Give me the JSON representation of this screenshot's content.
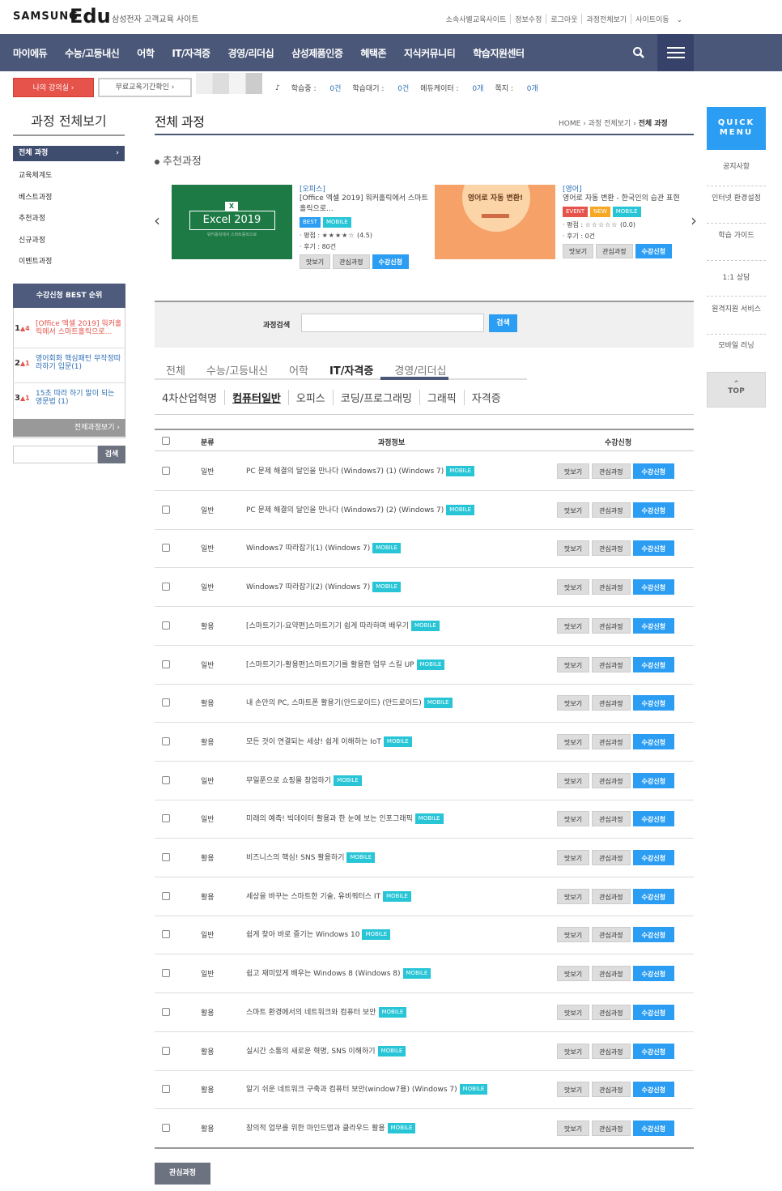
{
  "header": {
    "brand": "SAMSUNG",
    "logo": "Edu",
    "subtitle": "삼성전자 고객교육 사이트",
    "util": [
      "소속사별교육사이트",
      "정보수정",
      "로그아웃",
      "과정전체보기",
      "사이트이동"
    ],
    "util_arrow": "⌄"
  },
  "gnb": {
    "menus": [
      "마이에듀",
      "수능/고등내신",
      "어학",
      "IT/자격증",
      "경영/리더십",
      "삼성제품인증",
      "혜택존",
      "지식커뮤니티",
      "학습지원센터"
    ],
    "search_icon": "search-icon",
    "menu_icon": "hamburger-icon"
  },
  "subbar": {
    "my_class": "나의 강의실 ›",
    "free_period": "무료교육기간확인 ›",
    "music_note": "♪",
    "counts": [
      {
        "label": "학습중 : ",
        "value": "0건"
      },
      {
        "label": "학습대기 : ",
        "value": "0건"
      },
      {
        "label": "에듀케이터 : ",
        "value": "0개"
      },
      {
        "label": "쪽지 : ",
        "value": "0개"
      }
    ]
  },
  "left": {
    "title": "과정 전체보기",
    "active": "전체 과정",
    "active_arrow": "›",
    "items": [
      "교육체계도",
      "베스트과정",
      "추천과정",
      "신규과정",
      "이벤트과정"
    ],
    "best_title": "수강신청 BEST 순위",
    "best": [
      {
        "rank": "1",
        "arrow": "▲4",
        "text": "[Office 엑셀 2019] 워커홀릭에서 스마트홀릭으로..."
      },
      {
        "rank": "2",
        "arrow": "▲1",
        "text": "영어회화 핵심패턴 무작정따라하기 입문(1)"
      },
      {
        "rank": "3",
        "arrow": "▲1",
        "text": "15초 따라 하기 말이 되는 영문법 (1)"
      }
    ],
    "best_all": "전체과정보기 ›",
    "search_btn": "검색"
  },
  "quick": {
    "title": "QUICK MENU",
    "items": [
      "공지사항",
      "인터넷 환경설정",
      "학습 가이드",
      "1:1 상담",
      "원격지원 서비스",
      "모바일 러닝"
    ],
    "top_arrow": "⌃",
    "top": "TOP"
  },
  "main": {
    "title": "전체 과정",
    "breadcrumb": [
      "HOME",
      "과정 전체보기",
      "전체 과정"
    ],
    "crumb_sep": "›",
    "rec_title": "추천과정",
    "prev": "‹",
    "next": "›",
    "cards": [
      {
        "image_text": "Excel 2019",
        "image_icon": "X",
        "image_sub": "워커홀릭에서 스마트홀릭으로",
        "cat": "[오피스]",
        "name": "[Office 엑셀 2019] 워커홀릭에서 스마트홀릭으로...",
        "tags": [
          "BEST",
          "MOBILE"
        ],
        "rating_label": "· 평점 : ",
        "stars": "★★★★☆",
        "rating": "(4.5)",
        "reviews": "· 후기 : 80건"
      },
      {
        "image_text": "영어로 자동 변환!",
        "cat": "[영어]",
        "name": "영어로 자동 변환 - 한국인의 습관 표현",
        "tags": [
          "EVENT",
          "NEW",
          "MOBILE"
        ],
        "rating_label": "· 평점 : ",
        "stars": "☆☆☆☆☆",
        "rating": "(0.0)",
        "reviews": "· 후기 : 0건"
      }
    ],
    "card_buttons": [
      "맛보기",
      "관심과정",
      "수강신청"
    ],
    "search_label": "과정검색",
    "search_btn": "검색",
    "tabs": [
      "전체",
      "수능/고등내신",
      "어학",
      "IT/자격증",
      "경영/리더십"
    ],
    "subtabs": [
      "4차산업혁명",
      "컴퓨터일반",
      "오피스",
      "코딩/프로그래밍",
      "그래픽",
      "자격증"
    ],
    "table_head": [
      "분류",
      "과정정보",
      "수강신청"
    ],
    "mobile_tag": "MOBILE",
    "row_buttons": [
      "맛보기",
      "관심과정",
      "수강신청"
    ],
    "rows": [
      {
        "cat": "일반",
        "name": "PC 문제 해결의 달인을 만나다 (Windows7) (1) (Windows 7)"
      },
      {
        "cat": "일반",
        "name": "PC 문제 해결의 달인을 만나다 (Windows7) (2) (Windows 7)"
      },
      {
        "cat": "일반",
        "name": "Windows7 따라잡기(1) (Windows 7)"
      },
      {
        "cat": "일반",
        "name": "Windows7 따라잡기(2) (Windows 7)"
      },
      {
        "cat": "활용",
        "name": "[스마트기기-요약편]스마트기기 쉽게 따라하며 배우기"
      },
      {
        "cat": "일반",
        "name": "[스마트기기-활용편]스마트기기를 활용한 업무 스킬 UP"
      },
      {
        "cat": "활용",
        "name": "내 손안의 PC, 스마트폰 활용기(안드로이드) (안드로이드)"
      },
      {
        "cat": "활용",
        "name": "모든 것이 연결되는 세상! 쉽게 이해하는 IoT"
      },
      {
        "cat": "일반",
        "name": "무일푼으로 쇼핑몰 창업하기"
      },
      {
        "cat": "일반",
        "name": "미래의 예측! 빅데이터 활용과 한 눈에 보는 인포그래픽"
      },
      {
        "cat": "활용",
        "name": "비즈니스의 핵심! SNS 활용하기"
      },
      {
        "cat": "활용",
        "name": "세상을 바꾸는 스마트한 기술, 유비쿼터스 IT"
      },
      {
        "cat": "일반",
        "name": "쉽게 찾아 바로 즐기는 Windows 10"
      },
      {
        "cat": "일반",
        "name": "쉽고 재미있게 배우는 Windows 8 (Windows 8)"
      },
      {
        "cat": "활용",
        "name": "스마트 환경에서의 네트워크와 컴퓨터 보안"
      },
      {
        "cat": "활용",
        "name": "실시간 소통의 새로운 혁명, SNS 이해하기"
      },
      {
        "cat": "활용",
        "name": "알기 쉬운 네트워크 구축과 컴퓨터 보안(window7용) (Windows 7)"
      },
      {
        "cat": "활용",
        "name": "창의적 업무를 위한 마인드맵과 클라우드 활용"
      }
    ],
    "fav_btn": "관심과정"
  }
}
